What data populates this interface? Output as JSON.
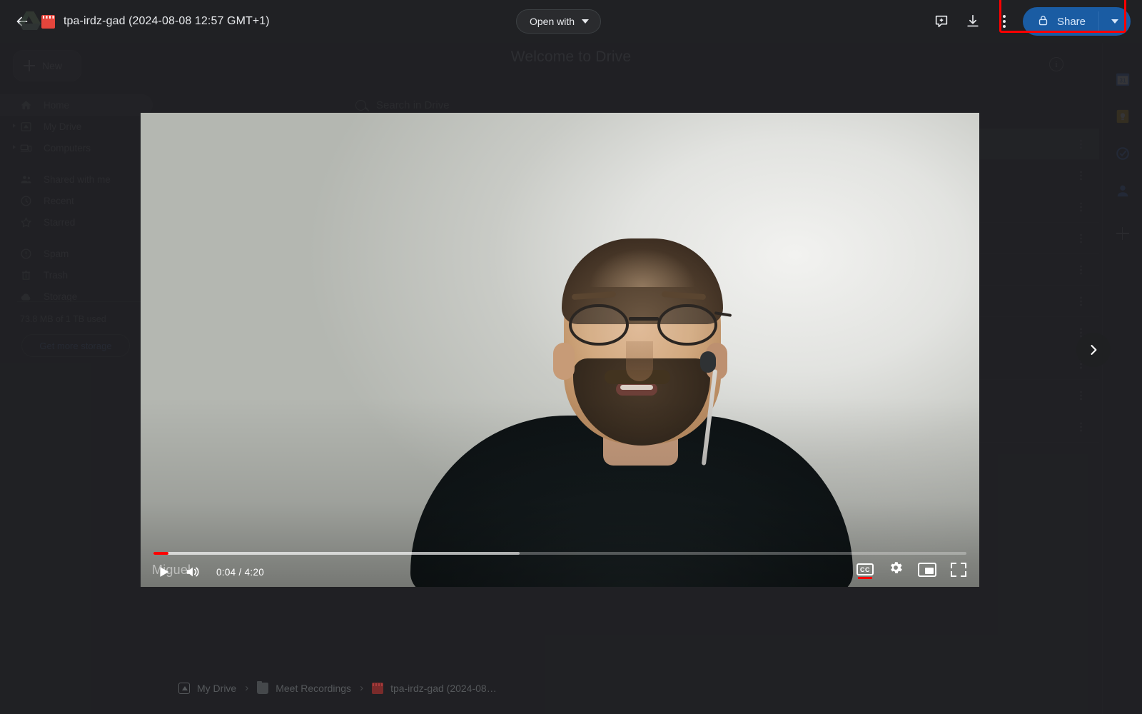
{
  "topbar": {
    "back_icon": "back-arrow-icon",
    "file_type_icon": "video-file-icon",
    "file_title": "tpa-irdz-gad (2024-08-08 12:57 GMT+1)",
    "open_with_label": "Open with",
    "add_comment_icon": "add-comment-icon",
    "download_icon": "download-icon",
    "more_options_icon": "more-vertical-icon",
    "share": {
      "label": "Share",
      "lock_icon": "lock-icon",
      "dropdown_icon": "chevron-down-icon",
      "bg_color": "#1a5ca3",
      "highlight_color": "#ff0000"
    }
  },
  "drive": {
    "welcome_title": "Welcome to Drive",
    "info_icon": "info-icon",
    "search": {
      "placeholder": "Search in Drive",
      "icon": "search-icon"
    },
    "new_button": {
      "label": "New",
      "icon": "plus-icon"
    },
    "nav_items": [
      {
        "label": "Home",
        "icon": "home-icon",
        "active": true,
        "expandable": false
      },
      {
        "label": "My Drive",
        "icon": "my-drive-icon",
        "active": false,
        "expandable": true
      },
      {
        "label": "Computers",
        "icon": "computers-icon",
        "active": false,
        "expandable": true
      },
      {
        "label": "Shared with me",
        "icon": "people-icon",
        "active": false,
        "expandable": false
      },
      {
        "label": "Recent",
        "icon": "clock-icon",
        "active": false,
        "expandable": false
      },
      {
        "label": "Starred",
        "icon": "star-icon",
        "active": false,
        "expandable": false
      },
      {
        "label": "Spam",
        "icon": "spam-icon",
        "active": false,
        "expandable": false
      },
      {
        "label": "Trash",
        "icon": "trash-icon",
        "active": false,
        "expandable": false
      },
      {
        "label": "Storage",
        "icon": "cloud-icon",
        "active": false,
        "expandable": false
      }
    ],
    "storage_used": "73.8 MB of 1 TB used",
    "get_more_storage_label": "Get more storage",
    "file_rows": [
      {
        "selected": true,
        "kebab": "more-vertical-icon"
      },
      {
        "selected": false,
        "kebab": "more-vertical-icon"
      },
      {
        "selected": false,
        "kebab": "more-vertical-icon"
      },
      {
        "selected": false,
        "kebab": "more-vertical-icon"
      },
      {
        "selected": false,
        "kebab": "more-vertical-icon"
      },
      {
        "selected": false,
        "kebab": "more-vertical-icon"
      },
      {
        "selected": false,
        "kebab": "more-vertical-icon"
      },
      {
        "selected": false,
        "kebab": "more-vertical-icon"
      },
      {
        "selected": false,
        "kebab": "more-vertical-icon"
      },
      {
        "selected": false,
        "kebab": "more-vertical-icon"
      }
    ],
    "side_rail": [
      {
        "icon": "google-calendar-icon"
      },
      {
        "icon": "google-keep-icon"
      },
      {
        "icon": "google-tasks-icon"
      },
      {
        "icon": "google-contacts-icon"
      },
      {
        "icon": "add-shortcut-icon"
      }
    ],
    "breadcrumb": [
      {
        "label": "My Drive",
        "icon": "my-drive-icon"
      },
      {
        "label": "Meet Recordings",
        "icon": "folder-icon"
      },
      {
        "label": "tpa-irdz-gad (2024-08…",
        "icon": "video-file-icon"
      }
    ],
    "breadcrumb_separator": "›"
  },
  "next_button": {
    "icon": "chevron-right-icon"
  },
  "player": {
    "current_time": "0:04",
    "duration": "4:20",
    "time_display": "0:04 / 4:20",
    "progress_percent": 1.8,
    "buffered_percent": 45,
    "progress_color": "#ff0000",
    "caption_text": "Miguel",
    "play_icon": "play-icon",
    "volume_icon": "volume-on-icon",
    "captions_label": "CC",
    "captions_icon": "captions-icon",
    "settings_icon": "gear-icon",
    "pip_icon": "picture-in-picture-icon",
    "fullscreen_icon": "fullscreen-icon"
  }
}
